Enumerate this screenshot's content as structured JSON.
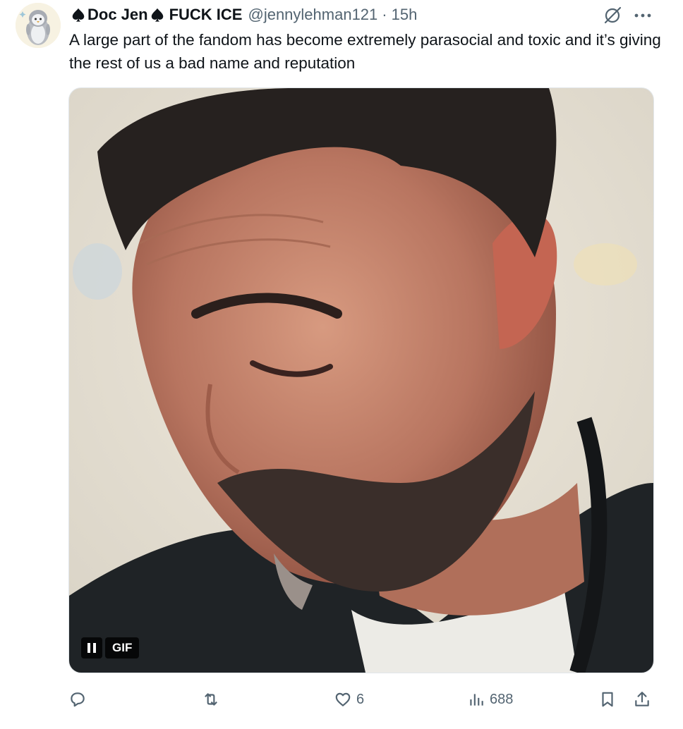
{
  "tweet": {
    "display_name_1": "Doc Jen",
    "display_name_2": "FUCK ICE",
    "handle": "@jennylehman121",
    "separator": "·",
    "time": "15h",
    "text": "A large part of the fandom has become extremely parasocial and toxic and it’s giving the rest of us a bad name and reputation"
  },
  "media": {
    "badge": "GIF"
  },
  "actions": {
    "reply_count": "",
    "retweet_count": "",
    "like_count": "6",
    "views_count": "688"
  },
  "colors": {
    "text": "#0f1419",
    "secondary": "#536471"
  },
  "icons": [
    "avatar-penguin",
    "spade-icon",
    "grok-icon",
    "more-icon",
    "pause-icon",
    "reply-icon",
    "retweet-icon",
    "like-icon",
    "views-icon",
    "bookmark-icon",
    "share-icon"
  ]
}
